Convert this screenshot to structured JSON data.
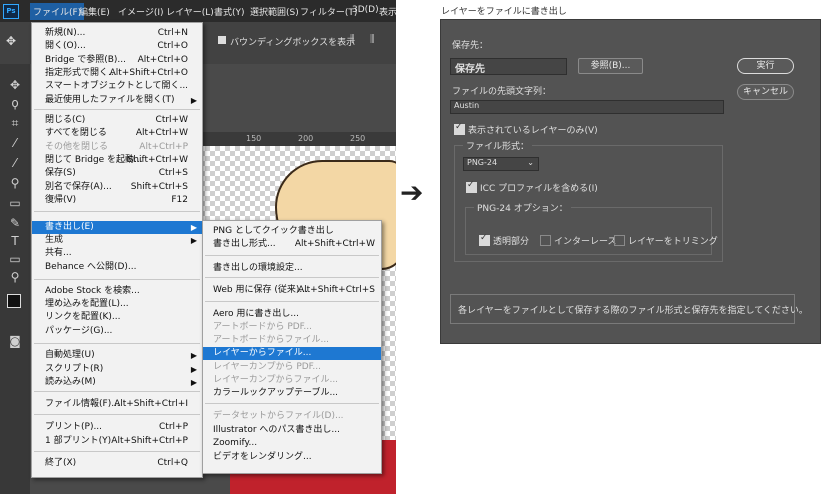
{
  "menubar": {
    "logo": "Ps",
    "items": [
      "ファイル(F)",
      "編集(E)",
      "イメージ(I)",
      "レイヤー(L)",
      "書式(Y)",
      "選択範囲(S)",
      "フィルター(T)",
      "3D(D)",
      "表示"
    ]
  },
  "options_bar": {
    "bounding_box_label": "バウンディングボックスを表示"
  },
  "ruler": [
    "150",
    "200",
    "250"
  ],
  "file_menu": {
    "items": [
      {
        "label": "新規(N)...",
        "shortcut": "Ctrl+N"
      },
      {
        "label": "開く(O)...",
        "shortcut": "Ctrl+O"
      },
      {
        "label": "Bridge で参照(B)...",
        "shortcut": "Alt+Ctrl+O"
      },
      {
        "label": "指定形式で開く...",
        "shortcut": "Alt+Shift+Ctrl+O"
      },
      {
        "label": "スマートオブジェクトとして開く...",
        "shortcut": ""
      },
      {
        "label": "最近使用したファイルを開く(T)",
        "shortcut": ""
      },
      {
        "label": "閉じる(C)",
        "shortcut": "Ctrl+W"
      },
      {
        "label": "すべてを閉じる",
        "shortcut": "Alt+Ctrl+W"
      },
      {
        "label": "その他を閉じる",
        "shortcut": "Alt+Ctrl+P"
      },
      {
        "label": "閉じて Bridge を起動...",
        "shortcut": "Shift+Ctrl+W"
      },
      {
        "label": "保存(S)",
        "shortcut": "Ctrl+S"
      },
      {
        "label": "別名で保存(A)...",
        "shortcut": "Shift+Ctrl+S"
      },
      {
        "label": "復帰(V)",
        "shortcut": "F12"
      },
      {
        "label": "書き出し(E)",
        "shortcut": ""
      },
      {
        "label": "生成",
        "shortcut": ""
      },
      {
        "label": "共有...",
        "shortcut": ""
      },
      {
        "label": "Behance へ公開(D)...",
        "shortcut": ""
      },
      {
        "label": "Adobe Stock を検索...",
        "shortcut": ""
      },
      {
        "label": "埋め込みを配置(L)...",
        "shortcut": ""
      },
      {
        "label": "リンクを配置(K)...",
        "shortcut": ""
      },
      {
        "label": "パッケージ(G)...",
        "shortcut": ""
      },
      {
        "label": "自動処理(U)",
        "shortcut": ""
      },
      {
        "label": "スクリプト(R)",
        "shortcut": ""
      },
      {
        "label": "読み込み(M)",
        "shortcut": ""
      },
      {
        "label": "ファイル情報(F)...",
        "shortcut": "Alt+Shift+Ctrl+I"
      },
      {
        "label": "プリント(P)...",
        "shortcut": "Ctrl+P"
      },
      {
        "label": "1 部プリント(Y)",
        "shortcut": "Alt+Shift+Ctrl+P"
      },
      {
        "label": "終了(X)",
        "shortcut": "Ctrl+Q"
      }
    ]
  },
  "export_menu": {
    "items": [
      {
        "label": "PNG としてクイック書き出し",
        "shortcut": ""
      },
      {
        "label": "書き出し形式...",
        "shortcut": "Alt+Shift+Ctrl+W"
      },
      {
        "label": "書き出しの環境設定...",
        "shortcut": ""
      },
      {
        "label": "Web 用に保存 (従来)...",
        "shortcut": "Alt+Shift+Ctrl+S"
      },
      {
        "label": "Aero 用に書き出し...",
        "shortcut": ""
      },
      {
        "label": "アートボードから PDF...",
        "shortcut": ""
      },
      {
        "label": "アートボードからファイル...",
        "shortcut": ""
      },
      {
        "label": "レイヤーからファイル...",
        "shortcut": ""
      },
      {
        "label": "レイヤーカンプから PDF...",
        "shortcut": ""
      },
      {
        "label": "レイヤーカンプからファイル...",
        "shortcut": ""
      },
      {
        "label": "カラールックアップテーブル...",
        "shortcut": ""
      },
      {
        "label": "データセットからファイル(D)...",
        "shortcut": ""
      },
      {
        "label": "Illustrator へのパス書き出し...",
        "shortcut": ""
      },
      {
        "label": "Zoomify...",
        "shortcut": ""
      },
      {
        "label": "ビデオをレンダリング...",
        "shortcut": ""
      }
    ]
  },
  "arrow": "➔",
  "dialog": {
    "title": "レイヤーをファイルに書き出し",
    "destination_label": "保存先：",
    "destination_value": "保存先",
    "browse_button": "参照(B)...",
    "run_button": "実行",
    "cancel_button": "キャンセル",
    "prefix_label": "ファイルの先頭文字列：",
    "prefix_value": "Austin",
    "visible_only": "表示されているレイヤーのみ(V)",
    "file_type_label": "ファイル形式：",
    "file_type_value": "PNG-24",
    "icc_profile": "ICC プロファイルを含める(I)",
    "png_options_label": "PNG-24 オプション：",
    "transparency": "透明部分",
    "interlace": "インターレース",
    "trim": "レイヤーをトリミング",
    "description": "各レイヤーをファイルとして保存する際のファイル形式と保存先を指定してください。"
  }
}
